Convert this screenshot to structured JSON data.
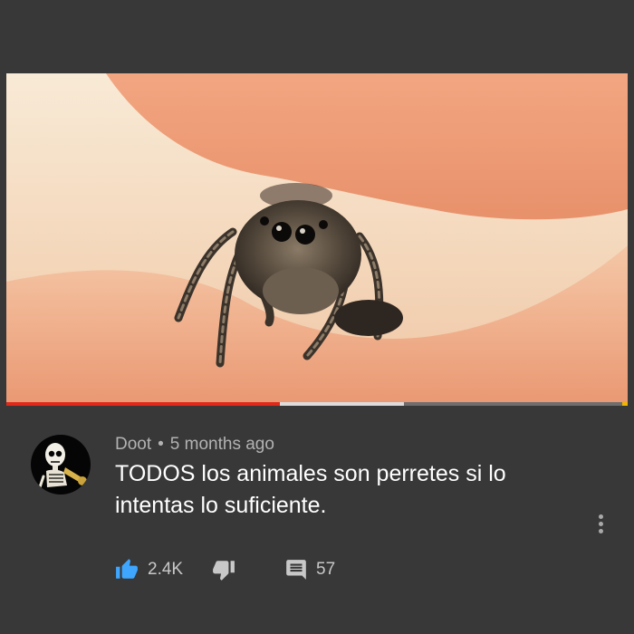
{
  "video": {
    "progress_played": 0.44,
    "progress_buffered": 0.64
  },
  "comment": {
    "author": "Doot",
    "separator": "•",
    "timestamp": "5 months ago",
    "text": "TODOS los animales son perretes si lo intentas lo suficiente."
  },
  "actions": {
    "like_count": "2.4K",
    "reply_count": "57"
  },
  "icons": {
    "like": "thumbs-up-icon",
    "dislike": "thumbs-down-icon",
    "reply": "comment-icon",
    "menu": "more-vertical-icon"
  },
  "colors": {
    "background": "#383838",
    "like_icon": "#3ea6ff",
    "progress_played": "#e0291b",
    "progress_buffered": "#dcdcdc"
  }
}
